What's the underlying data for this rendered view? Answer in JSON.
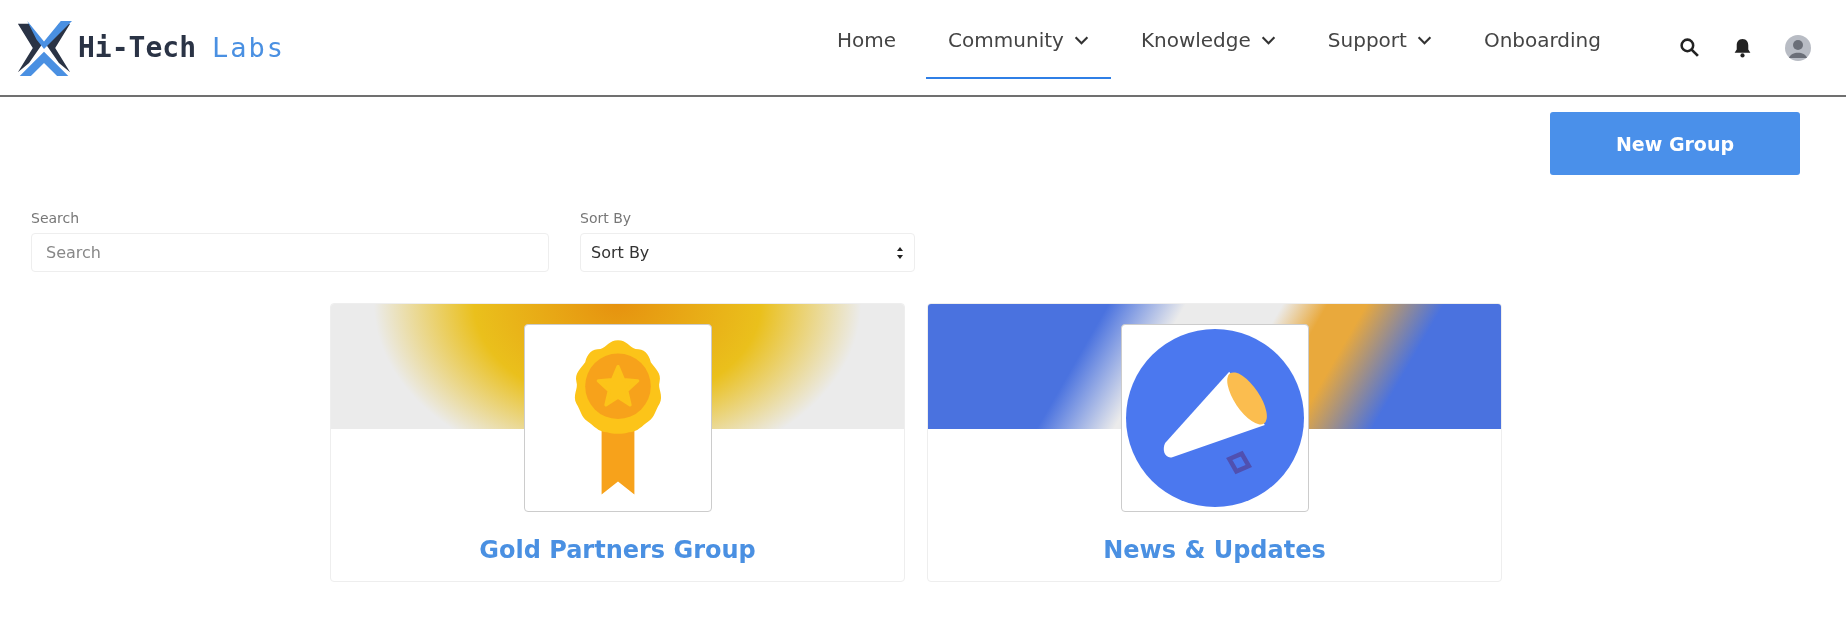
{
  "header": {
    "logo": {
      "primary": "Hi-Tech",
      "secondary": "Labs"
    },
    "nav": [
      {
        "label": "Home",
        "selected": false,
        "dropdown": false
      },
      {
        "label": "Community",
        "selected": true,
        "dropdown": true
      },
      {
        "label": "Knowledge",
        "selected": false,
        "dropdown": true
      },
      {
        "label": "Support",
        "selected": false,
        "dropdown": true
      },
      {
        "label": "Onboarding",
        "selected": false,
        "dropdown": false
      }
    ]
  },
  "actions": {
    "new_group": "New Group"
  },
  "filters": {
    "search": {
      "label": "Search",
      "placeholder": "Search"
    },
    "sort": {
      "label": "Sort By",
      "value": "Sort By"
    }
  },
  "groups": [
    {
      "name": "Gold Partners Group",
      "kind": "badge"
    },
    {
      "name": "News & Updates",
      "kind": "megaphone"
    }
  ]
}
